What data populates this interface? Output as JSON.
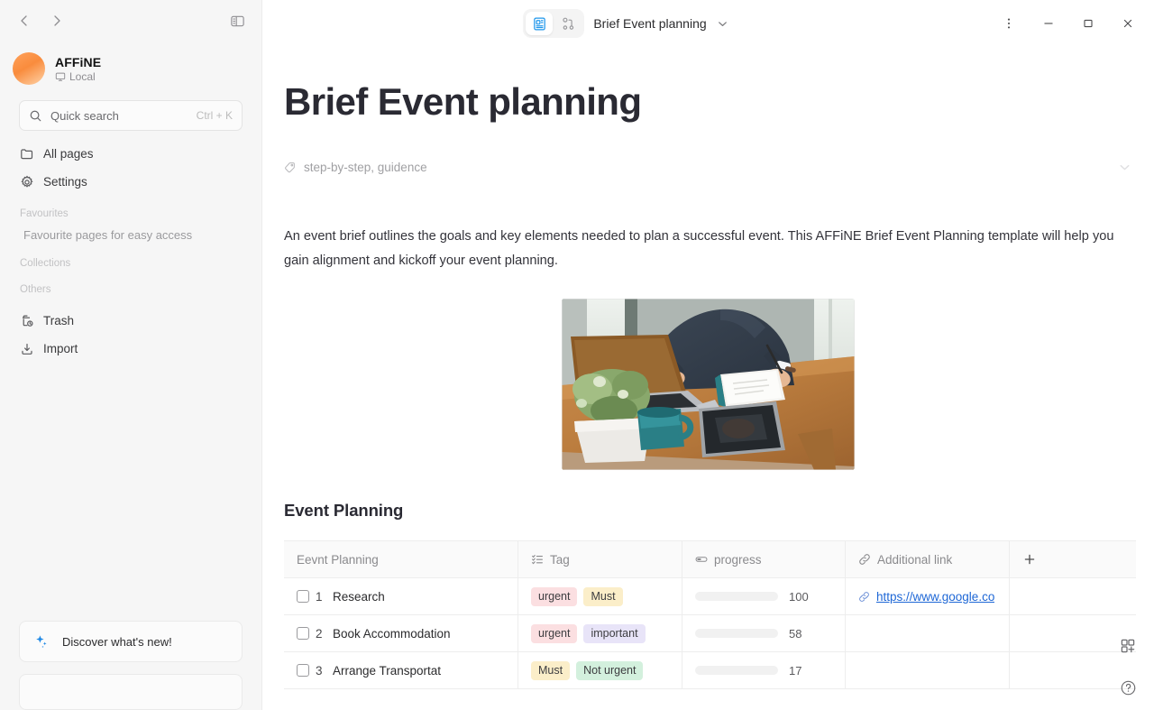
{
  "sidebar": {
    "nav_back_icon": "chevron-left-icon",
    "nav_forward_icon": "chevron-right-icon",
    "toggle_sidebar_icon": "sidebar-toggle-icon",
    "workspace": {
      "name": "AFFiNE",
      "sub": "Local",
      "sub_icon": "local-workspace-icon"
    },
    "search": {
      "placeholder": "Quick search",
      "shortcut": "Ctrl + K",
      "icon": "search-icon"
    },
    "nav_items": [
      {
        "label": "All pages",
        "icon": "folder-icon"
      },
      {
        "label": "Settings",
        "icon": "gear-icon"
      }
    ],
    "sections": [
      {
        "label": "Favourites",
        "hint": "Favourite pages for easy access"
      },
      {
        "label": "Collections",
        "hint": ""
      },
      {
        "label": "Others",
        "hint": ""
      }
    ],
    "other_items": [
      {
        "label": "Trash",
        "icon": "trash-icon"
      },
      {
        "label": "Import",
        "icon": "import-icon"
      }
    ],
    "discover": {
      "label": "Discover what's new!",
      "icon": "sparkle-icon"
    }
  },
  "header": {
    "title": "Brief Event planning",
    "mode_page_icon": "page-mode-icon",
    "mode_edgeless_icon": "edgeless-mode-icon",
    "title_chevron_icon": "chevron-down-icon",
    "more_icon": "more-vertical-icon",
    "minimize_icon": "minimize-icon",
    "maximize_icon": "maximize-icon",
    "close_icon": "close-icon",
    "active_mode": "page"
  },
  "doc": {
    "title": "Brief Event planning",
    "tags_icon": "tag-icon",
    "tags_text": "step-by-step, guidence",
    "tags_collapse_icon": "chevron-down-icon",
    "paragraph": "An event brief outlines the goals and key elements needed to plan a successful event. This AFFiNE Brief Event Planning template will help you gain alignment and kickoff your event planning.",
    "image_alt": "person-working-at-desk-photo",
    "section_heading": "Event Planning"
  },
  "table": {
    "columns": [
      {
        "label": "Eevnt Planning",
        "icon": ""
      },
      {
        "label": "Tag",
        "icon": "multi-select-icon"
      },
      {
        "label": "progress",
        "icon": "progress-icon"
      },
      {
        "label": "Additional link",
        "icon": "link-icon"
      },
      {
        "label": "",
        "icon": "plus-icon"
      }
    ],
    "rows": [
      {
        "num": "1",
        "title": "Research",
        "tags": [
          {
            "label": "urgent",
            "color": "#fbdfe1"
          },
          {
            "label": "Must",
            "color": "#fbeec9"
          }
        ],
        "progress": 100,
        "progress_label": "100",
        "progress_color": "#19c178",
        "link": "https://www.google.co",
        "link_icon": "link-icon"
      },
      {
        "num": "2",
        "title": "Book Accommodation",
        "tags": [
          {
            "label": "urgent",
            "color": "#fbdfe1"
          },
          {
            "label": "important",
            "color": "#e8e4f8"
          }
        ],
        "progress": 58,
        "progress_label": "58",
        "progress_color": "#1e67e6",
        "link": "",
        "link_icon": ""
      },
      {
        "num": "3",
        "title": "Arrange Transportat",
        "tags": [
          {
            "label": "Must",
            "color": "#fbeec9"
          },
          {
            "label": "Not urgent",
            "color": "#d3f0dd"
          }
        ],
        "progress": 17,
        "progress_label": "17",
        "progress_color": "#1e67e6",
        "link": "",
        "link_icon": ""
      }
    ]
  },
  "float_tools": [
    {
      "icon": "add-template-icon"
    },
    {
      "icon": "help-icon"
    }
  ]
}
